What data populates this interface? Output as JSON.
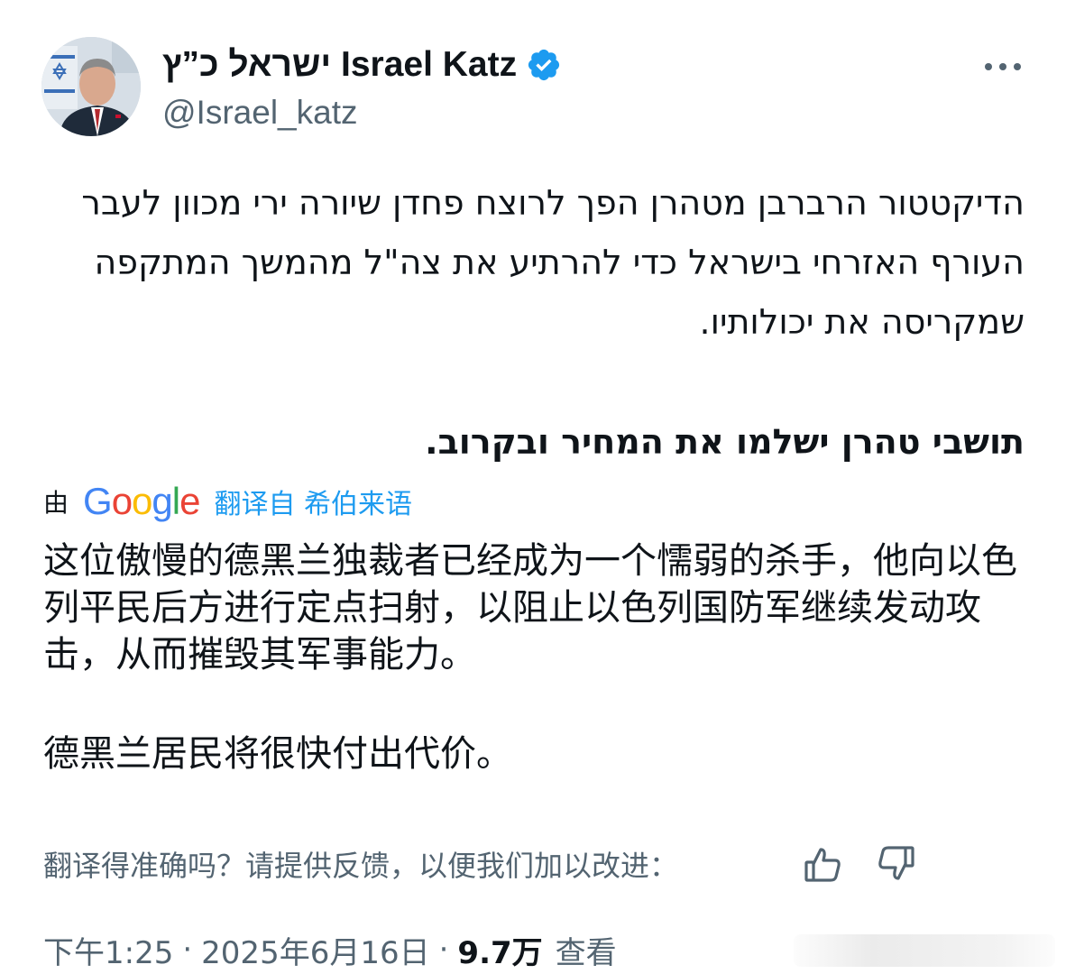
{
  "author": {
    "display_name": "ישראל כ”ץ Israel Katz",
    "handle": "@Israel_katz",
    "verified_icon": "verified-badge-icon",
    "avatar_icon": "user-avatar"
  },
  "tweet": {
    "hebrew_paragraph_1": "הדיקטטור הרברבן מטהרן הפך לרוצח פחדן שיורה ירי מכוון לעבר העורף האזרחי בישראל כדי להרתיע את צה\"ל מהמשך המתקפה שמקריסה את יכולותיו.",
    "hebrew_paragraph_2": "תושבי טהרן ישלמו את המחיר ובקרוב.",
    "translation": {
      "by_label": "由",
      "provider": "Google",
      "from_label": "翻译自 希伯来语",
      "paragraph_1": "这位傲慢的德黑兰独裁者已经成为一个懦弱的杀手，他向以色列平民后方进行定点扫射，以阻止以色列国防军继续发动攻击，从而摧毁其军事能力。",
      "paragraph_2": "德黑兰居民将很快付出代价。",
      "feedback_prompt": "翻译得准确吗？请提供反馈，以便我们加以改进："
    }
  },
  "meta": {
    "time": "下午1:25",
    "separator": "·",
    "date": "2025年6月16日",
    "views_count": "9.7万",
    "views_label": "查看"
  },
  "colors": {
    "accent": "#1d9bf0",
    "secondary_text": "#536471",
    "primary_text": "#0f1419"
  }
}
